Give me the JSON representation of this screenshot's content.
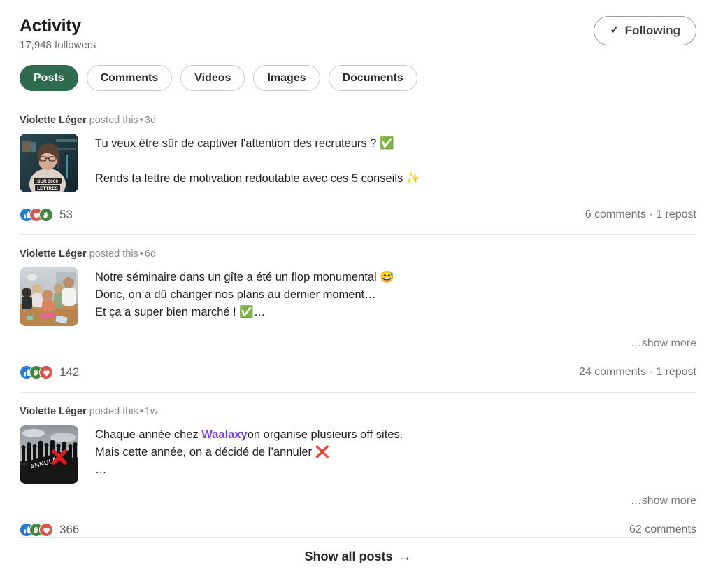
{
  "header": {
    "title": "Activity",
    "followers": "17,948 followers",
    "following_button": {
      "label": "Following",
      "check_glyph": "✓"
    }
  },
  "filters": {
    "active_index": 0,
    "items": [
      {
        "label": "Posts",
        "active": true
      },
      {
        "label": "Comments",
        "active": false
      },
      {
        "label": "Videos",
        "active": false
      },
      {
        "label": "Images",
        "active": false
      },
      {
        "label": "Documents",
        "active": false
      }
    ]
  },
  "colors": {
    "accent_green": "#2f6b4f",
    "mention_purple": "#7b3fe4",
    "reaction_like_blue": "#1f7ad4",
    "reaction_heart_red": "#d9544a",
    "reaction_clap_green": "#44883f",
    "text_primary": "#1f1f1f",
    "text_muted": "#8a8a8a"
  },
  "posts": [
    {
      "author": "Violette Léger",
      "action": "posted this",
      "separator": "•",
      "time": "3d",
      "thumbnail_name": "video-thumbnail-woman-sur-3000-lettres",
      "thumbnail_caption_line1": "SUR 3000",
      "thumbnail_caption_line2": "LETTRES",
      "lines": [
        "Tu veux être sûr de captiver l'attention des recruteurs ? ✅",
        "",
        "Rends ta lettre de motivation redoutable avec ces 5 conseils ✨"
      ],
      "show_more": "",
      "reactions": [
        "like",
        "heart",
        "clap"
      ],
      "reaction_count": "53",
      "engagement": "6 comments · 1 repost"
    },
    {
      "author": "Violette Léger",
      "action": "posted this",
      "separator": "•",
      "time": "6d",
      "thumbnail_name": "photo-thumbnail-team-workshop-table",
      "thumbnail_caption_line1": "",
      "thumbnail_caption_line2": "",
      "lines": [
        "Notre séminaire dans un gîte a été un flop monumental 😅",
        "Donc, on a dû changer nos plans au dernier moment…",
        "Et ça a super bien marché ! ✅…"
      ],
      "show_more": "…show more",
      "reactions": [
        "like",
        "clap",
        "heart"
      ],
      "reaction_count": "142",
      "engagement": "24 comments · 1 repost"
    },
    {
      "author": "Violette Léger",
      "action": "posted this",
      "separator": "•",
      "time": "1w",
      "thumbnail_name": "photo-thumbnail-annule-crowd-banner",
      "thumbnail_caption_line1": "ANNULÉ",
      "thumbnail_caption_line2": "",
      "lines": [
        "Chaque année chez |Waalaxy|on organise plusieurs off sites.",
        "Mais cette année, on a décidé de l’annuler ❌",
        "…"
      ],
      "mention": "Waalaxy",
      "show_more": "…show more",
      "reactions": [
        "like",
        "clap",
        "heart"
      ],
      "reaction_count": "366",
      "engagement": "62 comments"
    }
  ],
  "footer": {
    "show_all_label": "Show all posts",
    "arrow_glyph": "→"
  }
}
